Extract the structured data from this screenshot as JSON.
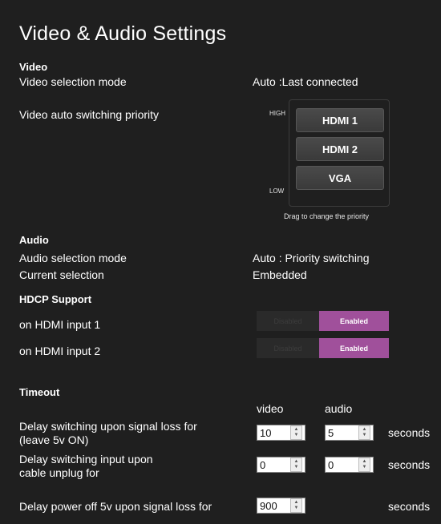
{
  "page": {
    "title": "Video & Audio Settings"
  },
  "video": {
    "heading": "Video",
    "selection_mode_label": "Video selection mode",
    "selection_mode_value": "Auto :Last connected",
    "priority_label": "Video auto switching priority",
    "priority_high": "HIGH",
    "priority_low": "LOW",
    "priority_items": [
      "HDMI 1",
      "HDMI 2",
      "VGA"
    ],
    "priority_hint": "Drag to change the priority"
  },
  "audio": {
    "heading": "Audio",
    "selection_mode_label": "Audio selection mode",
    "selection_mode_value": "Auto : Priority switching",
    "current_label": "Current selection",
    "current_value": "Embedded"
  },
  "hdcp": {
    "heading": "HDCP Support",
    "inputs": [
      {
        "label": "on HDMI input 1",
        "off_label": "Disabled",
        "on_label": "Enabled",
        "state": "Enabled"
      },
      {
        "label": "on HDMI input 2",
        "off_label": "Disabled",
        "on_label": "Enabled",
        "state": "Enabled"
      }
    ]
  },
  "timeout": {
    "heading": "Timeout",
    "col_video": "video",
    "col_audio": "audio",
    "unit": "seconds",
    "rows": [
      {
        "label_line1": "Delay switching upon signal loss for",
        "label_line2": "(leave 5v ON)",
        "video": "10",
        "audio": "5"
      },
      {
        "label_line1": "Delay switching input upon",
        "label_line2": "cable unplug for",
        "video": "0",
        "audio": "0"
      },
      {
        "label_line1": "Delay power off 5v upon signal loss for",
        "video": "900"
      }
    ]
  },
  "icons": {
    "spinner": "up-down-arrows-icon"
  },
  "colors": {
    "enabled": "#a0509b",
    "background": "#1f1f1f"
  }
}
